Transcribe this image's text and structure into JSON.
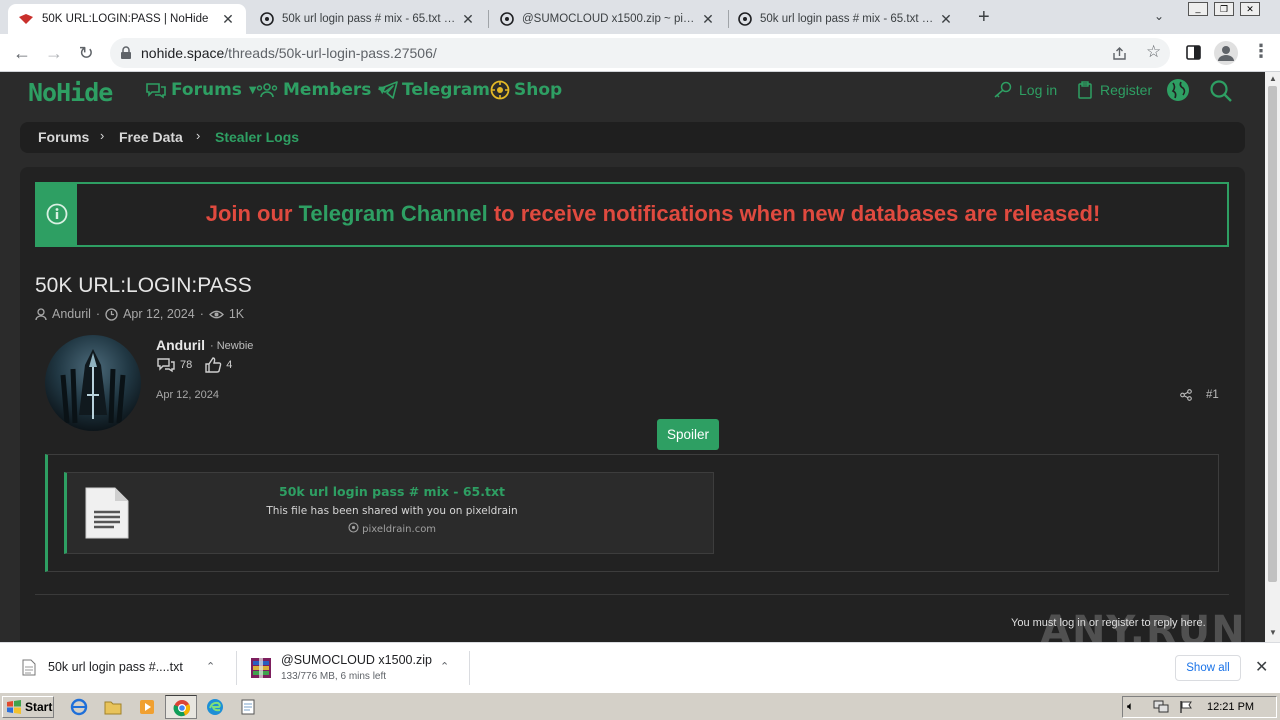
{
  "browser": {
    "tabs": [
      {
        "title": "50K URL:LOGIN:PASS | NoHide",
        "active": true
      },
      {
        "title": "50k url login pass # mix - 65.txt ~ pi",
        "active": false
      },
      {
        "title": "@SUMOCLOUD x1500.zip ~ pixeldra",
        "active": false
      },
      {
        "title": "50k url login pass # mix - 65.txt ~ pi",
        "active": false
      }
    ],
    "new_tab": "+",
    "url_host": "nohide.space",
    "url_path": "/threads/50k-url-login-pass.27506/"
  },
  "site": {
    "logo": "NoHide",
    "nav": {
      "forums": "Forums",
      "members": "Members",
      "telegram": "Telegram",
      "shop": "Shop",
      "login": "Log in",
      "register": "Register"
    },
    "breadcrumb": [
      "Forums",
      "Free Data",
      "Stealer Logs"
    ],
    "notice": {
      "before": "Join our ",
      "highlight": "Telegram Channel",
      "after": " to receive notifications when new databases are released!"
    }
  },
  "thread": {
    "title": "50K URL:LOGIN:PASS",
    "author": "Anduril",
    "date": "Apr 12, 2024",
    "views": "1K"
  },
  "post": {
    "username": "Anduril",
    "role": "· Newbie",
    "messages": "78",
    "reactions": "4",
    "date": "Apr 12, 2024",
    "number": "#1",
    "spoiler_label": "Spoiler",
    "embed": {
      "title": "50k url login pass # mix - 65.txt",
      "description": "This file has been shared with you on pixeldrain",
      "domain": "pixeldrain.com"
    },
    "reply_notice": "You must log in or register to reply here."
  },
  "downloads": [
    {
      "name": "50k url login pass #....txt",
      "status": ""
    },
    {
      "name": "@SUMOCLOUD x1500.zip",
      "status": "133/776 MB, 6 mins left"
    }
  ],
  "downloads_show_all": "Show all",
  "taskbar": {
    "start": "Start",
    "clock": "12:21 PM"
  },
  "watermark": "ANY.RUN",
  "colors": {
    "accent": "#2e9f63",
    "notice_red": "#e04a3f",
    "page_bg": "#2b2b2b"
  }
}
